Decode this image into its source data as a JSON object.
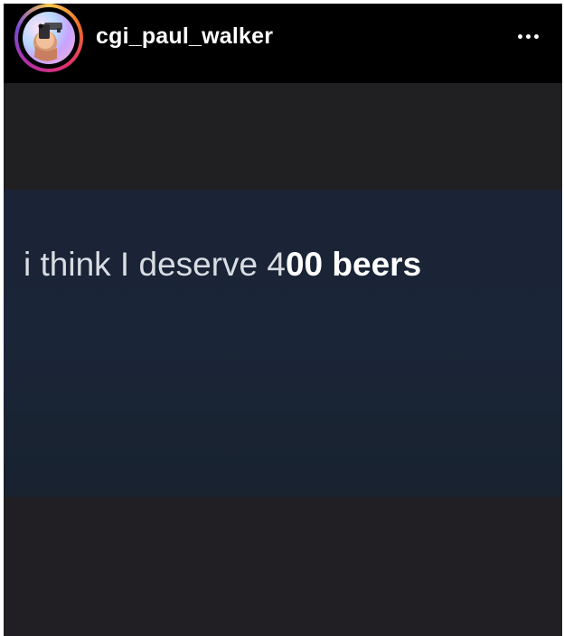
{
  "header": {
    "username": "cgi_paul_walker",
    "more_icon": "more-horizontal-icon",
    "avatar_icon": "profile-avatar-icon"
  },
  "post": {
    "text_part_a": "i think I deserve 4",
    "text_part_b": "00 beers"
  },
  "colors": {
    "background": "#000000",
    "post_background": "#1f1e21",
    "tweet_band": "#1a2537",
    "text_light": "#d9dde3",
    "text_bold": "#ffffff"
  }
}
